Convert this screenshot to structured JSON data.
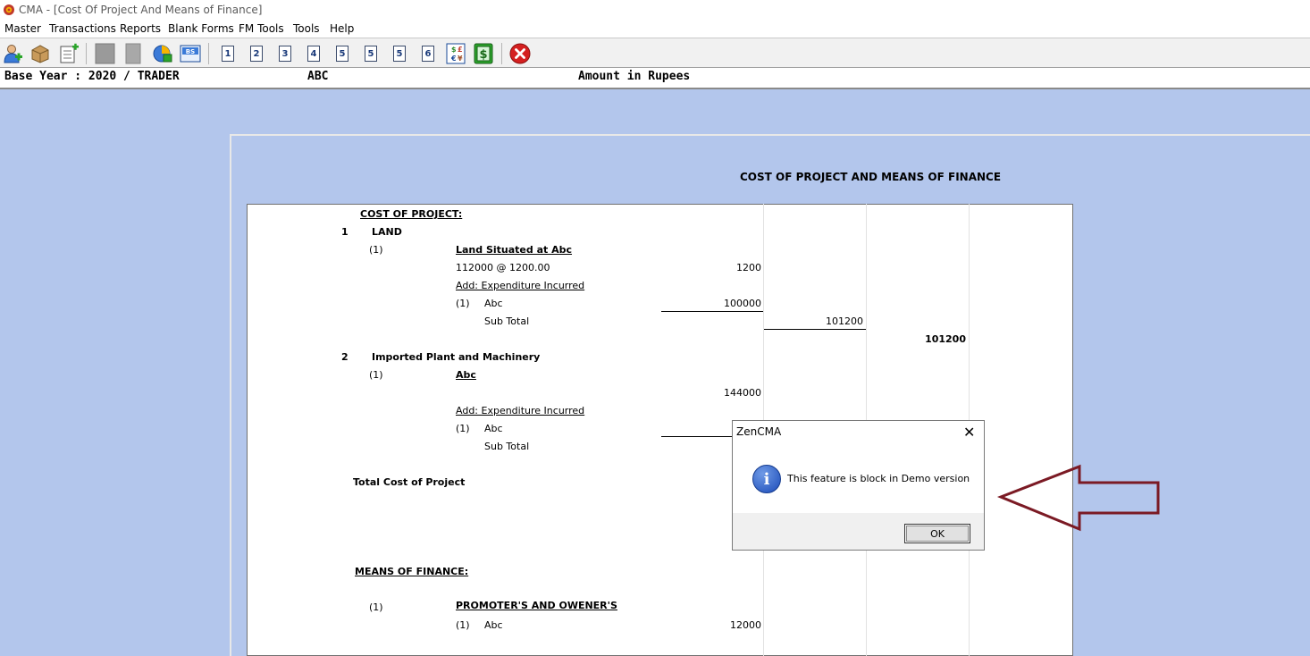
{
  "window": {
    "title": "CMA - [Cost Of Project And Means of Finance]"
  },
  "menu": [
    "Master",
    "Transactions",
    "Reports",
    "Blank Forms",
    "FM Tools",
    "Tools",
    "Help"
  ],
  "toolbar": {
    "page_buttons": [
      "1",
      "2",
      "3",
      "4",
      "5",
      "5",
      "5",
      "6"
    ],
    "icons": [
      "add-user-icon",
      "package-icon",
      "document-add-icon",
      "gray-block-icon",
      "gray-page-icon",
      "chart-globe-icon",
      "balance-sheet-icon",
      "currency-icon",
      "dollar-icon",
      "exit-icon"
    ],
    "bs_label": "BS"
  },
  "info": {
    "base_year": "Base Year : 2020 / TRADER",
    "company": "ABC",
    "amount_unit": "Amount in Rupees"
  },
  "report": {
    "heading": "COST OF PROJECT AND MEANS OF FINANCE",
    "cost_of_project_label": "COST OF PROJECT:",
    "items": [
      {
        "no": "1",
        "name": "LAND",
        "sub_no": "(1)",
        "sub_name": "Land Situated at Abc",
        "rate_text": "112000 @ 1200.00",
        "rate_value": "1200",
        "add_label": "Add: Expenditure Incurred",
        "exp_no": "(1)",
        "exp_name": "Abc",
        "exp_value": "100000",
        "subtotal_label": "Sub Total",
        "subtotal_value": "101200",
        "total": "101200"
      },
      {
        "no": "2",
        "name": "Imported Plant and Machinery",
        "sub_no": "(1)",
        "sub_name": "Abc",
        "value": "144000",
        "add_label": "Add: Expenditure Incurred",
        "exp_no": "(1)",
        "exp_name": "Abc",
        "subtotal_label": "Sub Total"
      }
    ],
    "total_cost_label": "Total Cost of Project",
    "means_of_finance_label": "MEANS OF FINANCE:",
    "finance": {
      "no": "(1)",
      "name": "PROMOTER'S AND OWENER'S",
      "item_no": "(1)",
      "item_name": "Abc",
      "item_value": "12000"
    }
  },
  "dialog": {
    "title": "ZenCMA",
    "close": "✕",
    "icon": "i",
    "message": "This feature is block in Demo version",
    "ok": "OK"
  },
  "colors": {
    "workspace": "#b3c6ec",
    "arrow": "#7b1a24",
    "exit_button": "#d42020"
  }
}
